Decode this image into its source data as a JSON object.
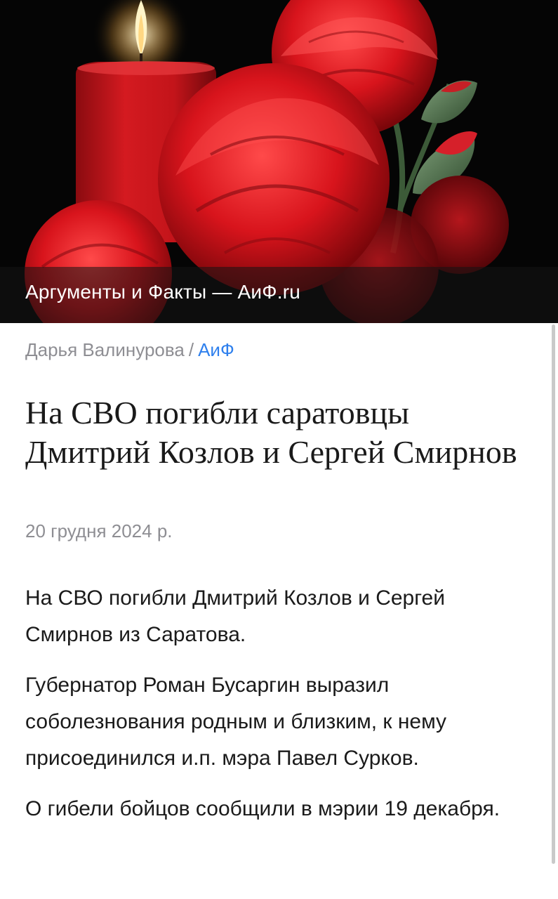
{
  "hero": {
    "source_caption": "Аргументы и Факты — АиФ.ru",
    "image_subject": "candle-and-carnations-image"
  },
  "article": {
    "author": "Дарья Валинурова",
    "separator": "/",
    "source": "АиФ",
    "title": "На СВО погибли саратовцы Дмитрий Козлов и Сергей Смирнов",
    "date": "20 грудня 2024 р.",
    "paragraphs": [
      "На СВО погибли Дмитрий Козлов и Сергей Смирнов из Саратова.",
      "Губернатор Роман Бусаргин выразил соболезнования родным и близким, к нему присоединился и.п. мэра Павел Сурков.",
      "О гибели бойцов сообщили в мэрии 19 декабря."
    ]
  },
  "colors": {
    "link": "#2f80ed",
    "meta_text": "#8e8e93",
    "body_text": "#1a1a1a",
    "hero_background": "#050505",
    "carnation_red": "#d8141c",
    "candle_red": "#c8161c"
  }
}
